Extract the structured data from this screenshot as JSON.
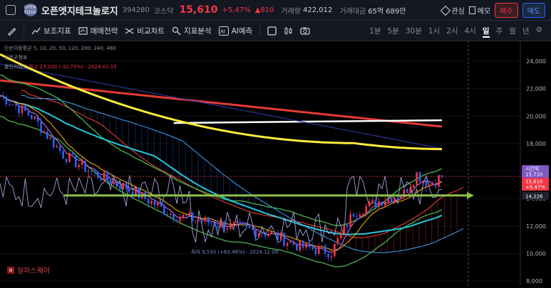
{
  "header": {
    "logo_text": "OPEN EDGE",
    "name": "오픈엣지테크놀로지",
    "code": "394280",
    "market": "코스닥",
    "price": "15,610",
    "change_pct": "+5.47%",
    "change_abs": "▲810",
    "volume_label": "거래량",
    "volume": "422,012",
    "amount_label": "거래대금",
    "amount": "65억 689만",
    "watch_label": "관심",
    "memo_label": "메모",
    "buy_label": "매수",
    "sell_label": "매도"
  },
  "toolbar": {
    "indicators": "보조지표",
    "strategy": "매매전략",
    "compare": "비교차트",
    "analysis": "지표분석",
    "ai": "AI예측",
    "intervals": [
      "1분",
      "5분",
      "30분",
      "1시",
      "2시",
      "4시",
      "일",
      "주",
      "월",
      "년"
    ],
    "selected_interval": "일"
  },
  "legend": {
    "ma": "단순이동평균",
    "ma_params": "5, 10, 20, 50, 120, 200, 240, 480",
    "ichimoku": "일목균형표",
    "bollinger": "볼린저밴드",
    "high_note": "최고 23,200 (-32.72%) · 2024.01.15"
  },
  "annotations": {
    "low": "최저 9,550 (+63.46%) · 2024.12.09"
  },
  "watermark": "알파스퀘어",
  "chart_data": {
    "type": "line",
    "y_ticks": [
      8000,
      10000,
      12000,
      14000,
      16000,
      18000,
      20000,
      22000,
      24000
    ],
    "y_tick_labels": [
      "8,000",
      "10,000",
      "12,000",
      "14,000",
      "16,000",
      "18,000",
      "20,000",
      "22,000",
      "24,000"
    ],
    "ylim": [
      7700,
      25500
    ],
    "price_tags": [
      {
        "label": "시간외",
        "value": "15,710",
        "price": 15710,
        "color": "#7e57c2"
      },
      {
        "label": "15,610",
        "value": "+5.47%",
        "price": 15610,
        "color": "#f23645"
      },
      {
        "label": "14,226",
        "value": "",
        "price": 14226,
        "color": "#1e222d"
      }
    ],
    "colors": {
      "up": "#f23645",
      "down": "#2962ff",
      "horizontal_line": "#8bc34a",
      "ma_yellow": "#ffeb3b",
      "ma_red": "#e53935",
      "ma_white": "#ffffff",
      "ma_cyan": "#26c6da",
      "bollinger": "#43a047",
      "ichimoku_fast": "#f44336",
      "ichimoku_slow": "#42a5f5"
    }
  }
}
